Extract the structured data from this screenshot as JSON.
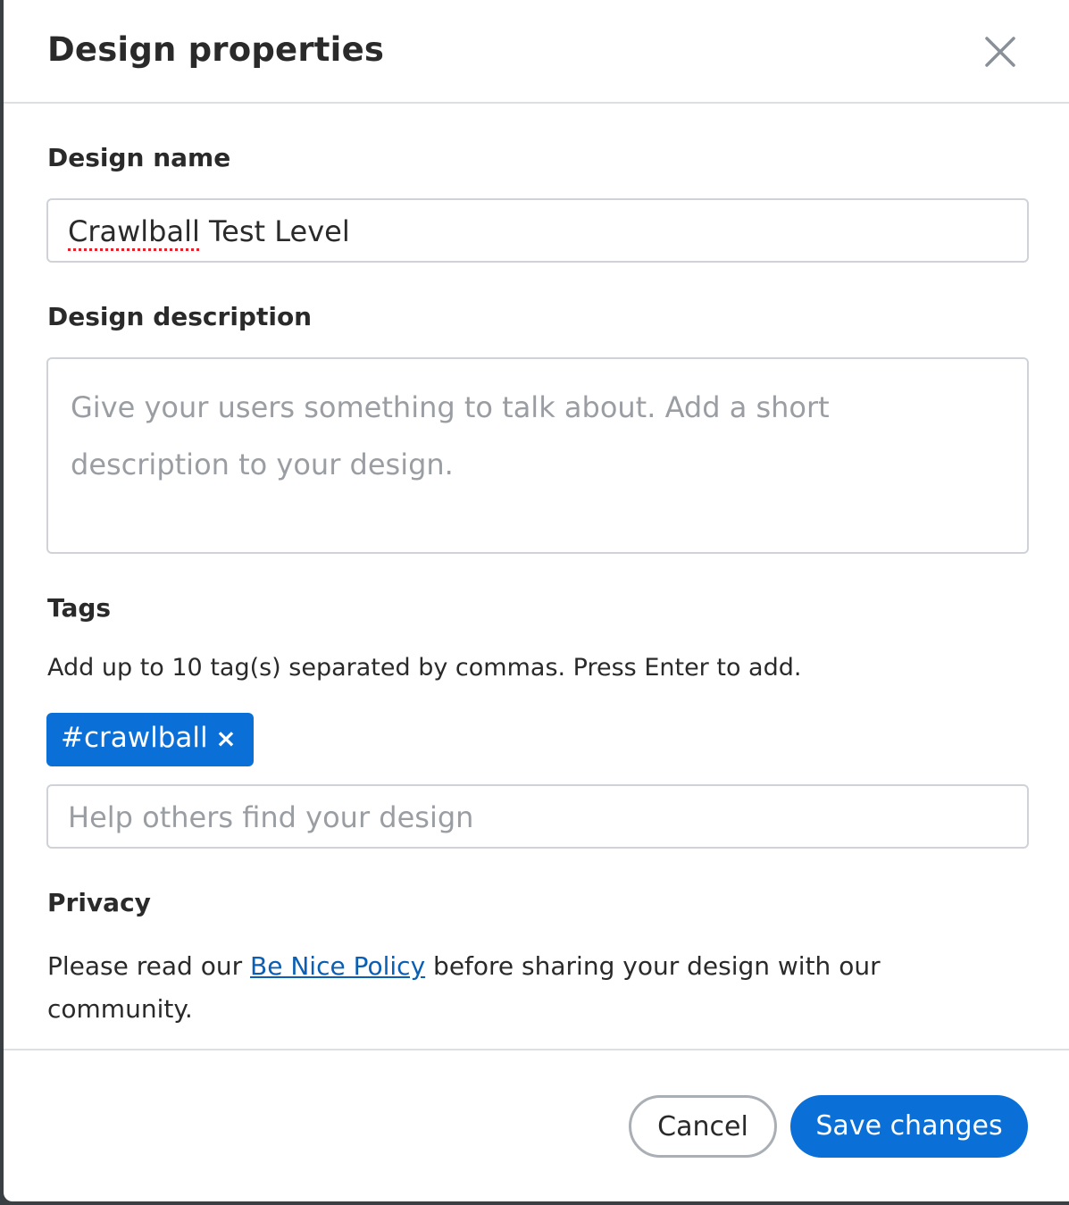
{
  "dialog": {
    "title": "Design properties"
  },
  "name_field": {
    "label": "Design name",
    "value_misspelled": "Crawlball",
    "value_rest": " Test Level"
  },
  "description_field": {
    "label": "Design description",
    "placeholder": "Give your users something to talk about. Add a short description to your design."
  },
  "tags": {
    "label": "Tags",
    "help": "Add up to 10 tag(s) separated by commas. Press Enter to add.",
    "items": [
      {
        "text": "#crawlball",
        "remove": "×"
      }
    ],
    "input_placeholder": "Help others find your design"
  },
  "privacy": {
    "label": "Privacy",
    "text_before": "Please read our ",
    "link": "Be Nice Policy",
    "text_after": " before sharing your design with our community."
  },
  "footer": {
    "cancel_label": "Cancel",
    "save_label": "Save changes"
  },
  "colors": {
    "primary": "#0a6fd6",
    "link": "#0a5fb4",
    "placeholder": "#9a9ea3"
  }
}
